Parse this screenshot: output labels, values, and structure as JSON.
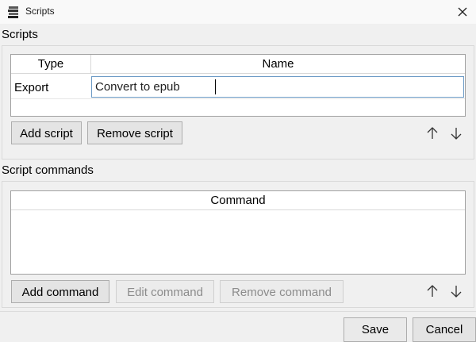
{
  "window": {
    "title": "Scripts"
  },
  "scripts_section": {
    "label": "Scripts",
    "columns": [
      "Type",
      "Name"
    ],
    "rows": [
      {
        "type": "Export",
        "name": "Convert to epub"
      }
    ],
    "buttons": {
      "add": "Add script",
      "remove": "Remove script"
    }
  },
  "commands_section": {
    "label": "Script commands",
    "columns": [
      "Command"
    ],
    "buttons": {
      "add": "Add command",
      "edit": "Edit command",
      "remove": "Remove command"
    }
  },
  "footer": {
    "save": "Save",
    "cancel": "Cancel"
  },
  "colors": {
    "highlight": "#f4f27a",
    "edit_border": "#6d9bc6"
  },
  "icons": {
    "app": "stack-icon",
    "close": "close-icon",
    "up": "arrow-up-icon",
    "down": "arrow-down-icon"
  }
}
